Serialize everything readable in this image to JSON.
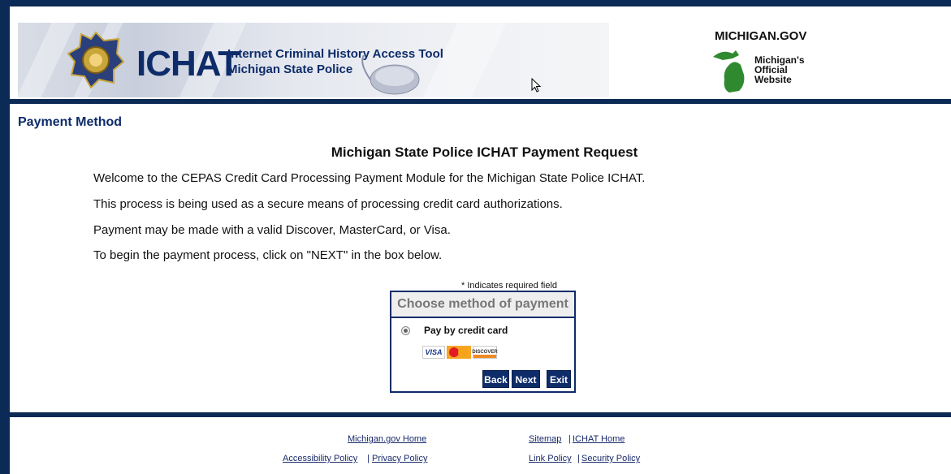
{
  "header": {
    "logo_word": "ICHAT",
    "logo_tagline_1": "Internet Criminal History Access Tool",
    "logo_tagline_2": "Michigan State Police",
    "michigan_title": "MICHIGAN.GOV",
    "michigan_lines": [
      "Michigan's",
      "Official",
      "Website"
    ]
  },
  "main": {
    "section_title": "Payment Method",
    "heading": "Michigan State Police ICHAT Payment Request",
    "paragraphs": [
      "Welcome to the CEPAS Credit Card Processing Payment Module for the Michigan State Police ICHAT.",
      "This process is being used as a secure means of processing credit card authorizations.",
      "Payment may be made with a valid Discover, MasterCard, or Visa.",
      "To begin the payment process, click on \"NEXT\" in the box below."
    ]
  },
  "payment": {
    "required_note": "* Indicates required field",
    "box_title": "Choose method of payment",
    "option_label": "Pay by credit card",
    "option_selected": true,
    "cards": [
      "VISA",
      "MasterCard",
      "DISCOVER"
    ],
    "buttons": {
      "back": "Back",
      "next": "Next",
      "exit": "Exit"
    }
  },
  "footer": {
    "michigan_home": "Michigan.gov Home",
    "sitemap": "Sitemap",
    "ichat_home": "ICHAT Home",
    "accessibility": "Accessibility Policy",
    "privacy": "Privacy Policy",
    "link_policy": "Link Policy",
    "security": "Security Policy",
    "separator": "|"
  },
  "colors": {
    "navy": "#0b2a55",
    "brand_blue": "#0e2c6a"
  }
}
